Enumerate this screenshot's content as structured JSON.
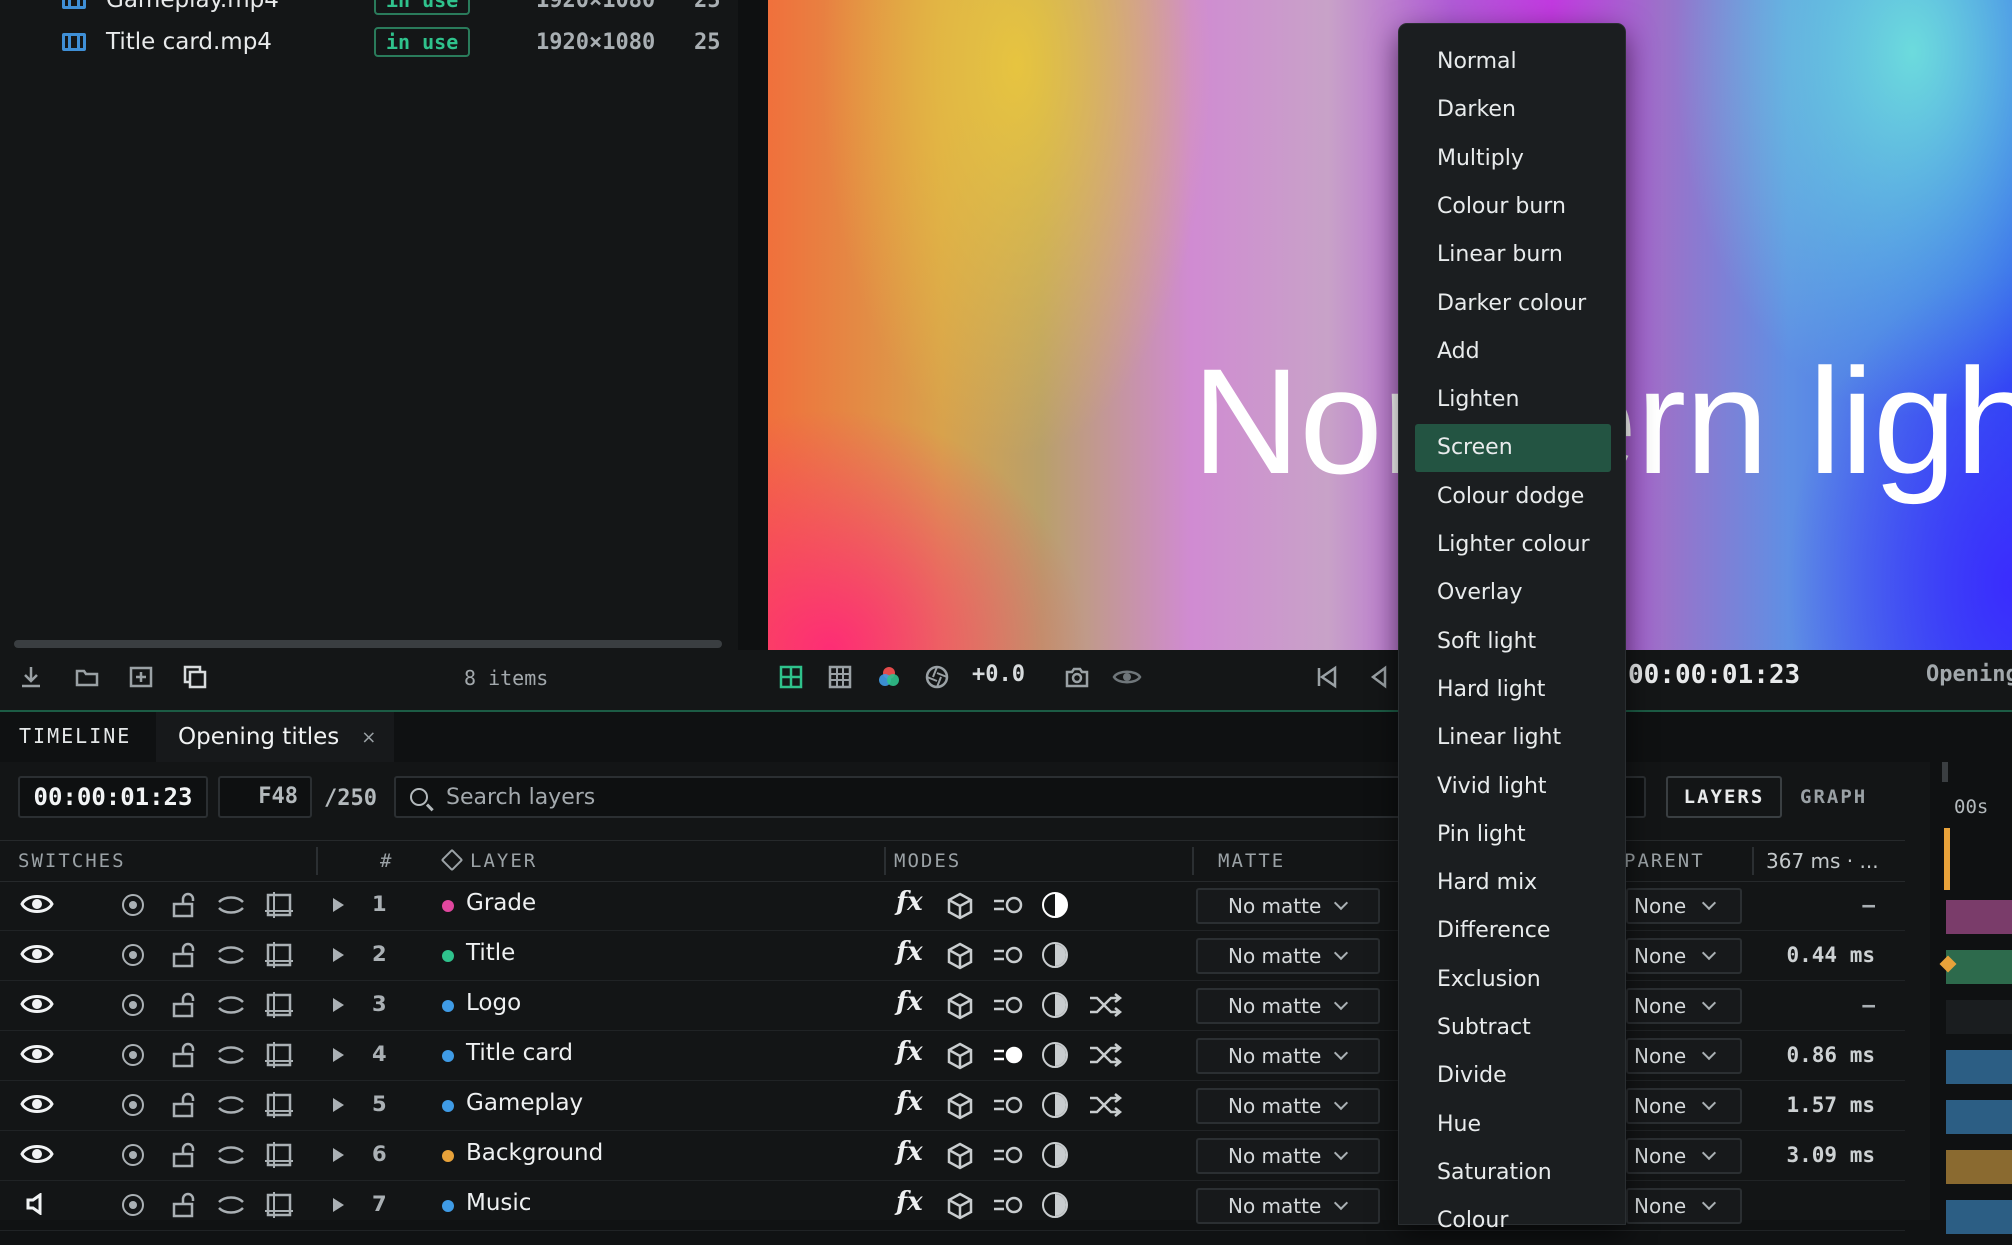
{
  "project": {
    "assets": [
      {
        "name": "Gameplay.mp4",
        "badge": "in use",
        "resolution": "1920×1080",
        "fps": "25"
      },
      {
        "name": "Title card.mp4",
        "badge": "in use",
        "resolution": "1920×1080",
        "fps": "25"
      }
    ],
    "items_count": "8 items"
  },
  "viewer": {
    "overlay_text": "Northern lights",
    "exposure": "+0.0",
    "timecode": "00:00:01:23",
    "comp_label": "Opening titles"
  },
  "tabs": {
    "panel_label": "TIMELINE",
    "comp_tab": "Opening titles",
    "close_glyph": "×"
  },
  "timeline": {
    "timecode": "00:00:01:23",
    "frame": "F48",
    "frame_total": "/250",
    "search_placeholder": "Search layers",
    "view_layers": "LAYERS",
    "view_graph": "GRAPH",
    "columns": {
      "switches": "SWITCHES",
      "num": "#",
      "layer": "LAYER",
      "modes": "MODES",
      "matte": "MATTE",
      "parent": "PARENT",
      "timing": "367 ms · ..."
    },
    "ruler_label": "00s",
    "layers": [
      {
        "num": "1",
        "name": "Grade",
        "color": "#e0479e",
        "matte": "No matte",
        "parent": "None",
        "time": "–",
        "adj_on": true,
        "shuffle": false
      },
      {
        "num": "2",
        "name": "Title",
        "color": "#2fc28c",
        "matte": "No matte",
        "parent": "None",
        "time": "0.44 ms",
        "adj_on": false,
        "shuffle": false
      },
      {
        "num": "3",
        "name": "Logo",
        "color": "#3f9be6",
        "matte": "No matte",
        "parent": "None",
        "time": "–",
        "adj_on": false,
        "shuffle": true
      },
      {
        "num": "4",
        "name": "Title card",
        "color": "#3f9be6",
        "matte": "No matte",
        "parent": "None",
        "time": "0.86 ms",
        "adj_on": false,
        "shuffle": true
      },
      {
        "num": "5",
        "name": "Gameplay",
        "color": "#3f9be6",
        "matte": "No matte",
        "parent": "None",
        "time": "1.57 ms",
        "adj_on": false,
        "shuffle": true
      },
      {
        "num": "6",
        "name": "Background",
        "color": "#e8a23a",
        "matte": "No matte",
        "parent": "None",
        "time": "3.09 ms",
        "adj_on": false,
        "shuffle": false
      },
      {
        "num": "7",
        "name": "Music",
        "color": "#3f9be6",
        "matte": "No matte",
        "parent": "None",
        "time": "",
        "adj_on": false,
        "shuffle": false
      }
    ]
  },
  "blend_menu": {
    "selected": "Screen",
    "items": [
      "Normal",
      "Darken",
      "Multiply",
      "Colour burn",
      "Linear burn",
      "Darker colour",
      "Add",
      "Lighten",
      "Screen",
      "Colour dodge",
      "Lighter colour",
      "Overlay",
      "Soft light",
      "Hard light",
      "Linear light",
      "Vivid light",
      "Pin light",
      "Hard mix",
      "Difference",
      "Exclusion",
      "Subtract",
      "Divide",
      "Hue",
      "Saturation",
      "Colour"
    ]
  },
  "colors": {
    "accent": "#2fc28c",
    "selection": "#235442"
  }
}
